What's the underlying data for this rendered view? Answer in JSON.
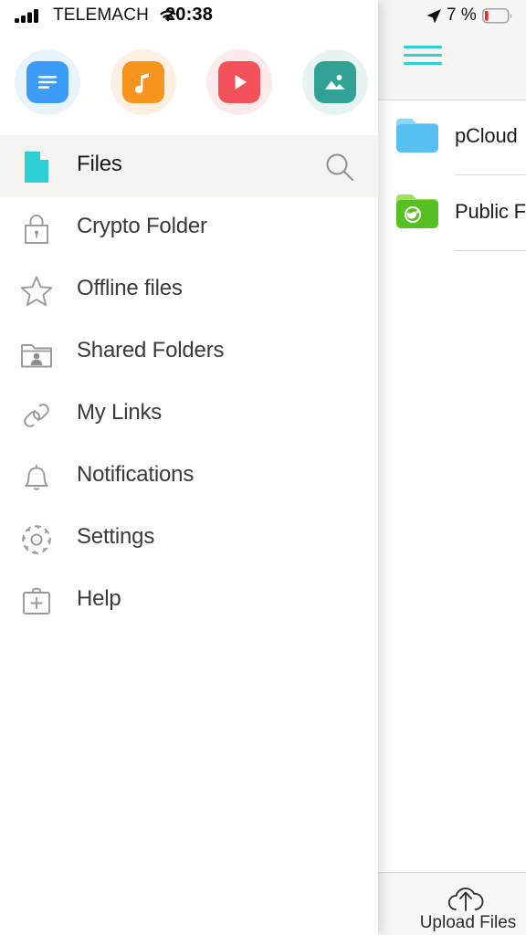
{
  "status_bar": {
    "carrier": "TELEMACH",
    "time": "20:38",
    "battery_percent": "7 %",
    "signal_icon": "cellular-signal-icon",
    "wifi_icon": "wifi-icon",
    "location_icon": "location-arrow-icon",
    "battery_icon": "battery-low-icon",
    "battery_color": "#f22a1e"
  },
  "categories": [
    {
      "name": "documents",
      "icon": "document-lines-icon",
      "color": "#3d9cf5",
      "bg": "#e8f3fe"
    },
    {
      "name": "music",
      "icon": "music-note-icon",
      "color": "#f7941e",
      "bg": "#fdf0e3"
    },
    {
      "name": "video",
      "icon": "play-triangle-icon",
      "color": "#f4515b",
      "bg": "#fdeaec"
    },
    {
      "name": "photos",
      "icon": "image-mountain-icon",
      "color": "#32a195",
      "bg": "#e8f4f2"
    }
  ],
  "menu": {
    "items": [
      {
        "label": "Files",
        "icon": "file-page-icon",
        "active": true,
        "accent": "#2ed0d6"
      },
      {
        "label": "Crypto Folder",
        "icon": "lock-icon",
        "active": false
      },
      {
        "label": "Offline files",
        "icon": "star-outline-icon",
        "active": false
      },
      {
        "label": "Shared Folders",
        "icon": "shared-folder-user-icon",
        "active": false
      },
      {
        "label": "My Links",
        "icon": "link-chain-icon",
        "active": false
      },
      {
        "label": "Notifications",
        "icon": "bell-icon",
        "active": false
      },
      {
        "label": "Settings",
        "icon": "gear-icon",
        "active": false
      },
      {
        "label": "Help",
        "icon": "briefcase-plus-icon",
        "active": false
      }
    ],
    "search_icon": "search-icon"
  },
  "content_panel": {
    "menu_icon": "hamburger-menu-icon",
    "menu_icon_color": "#2ed0d6",
    "rows": [
      {
        "label": "pCloud",
        "icon": "folder-blue-icon",
        "color": "#56c0f0"
      },
      {
        "label": "Public F",
        "icon": "folder-green-globe-icon",
        "color": "#56c022"
      }
    ],
    "upload": {
      "label": "Upload Files",
      "icon": "cloud-upload-icon"
    }
  }
}
